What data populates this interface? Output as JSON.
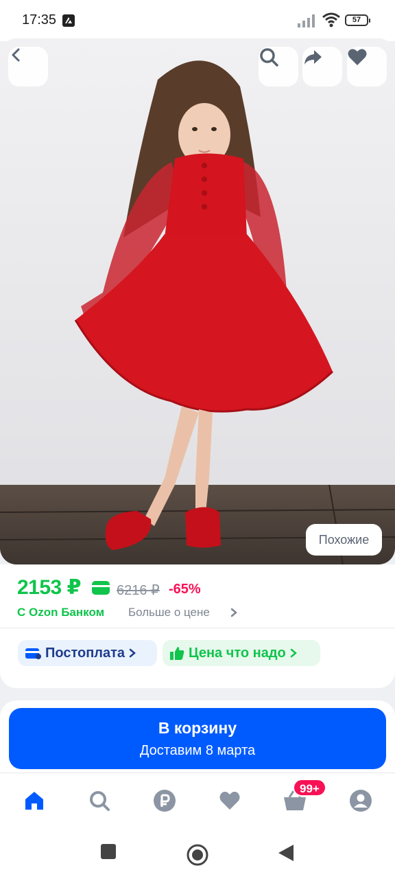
{
  "status_bar": {
    "time": "17:35",
    "battery": "57"
  },
  "product": {
    "image_description_icons": [
      "back-arrow-icon",
      "search-icon",
      "share-icon",
      "heart-icon"
    ],
    "similar_label": "Похожие"
  },
  "price": {
    "current": "2153 ₽",
    "old": "6216 ₽",
    "discount": "-65%",
    "bank_label": "С Ozon Банком",
    "more_label": "Больше о цене"
  },
  "chips": {
    "postpay": "Постоплата",
    "fair_price": "Цена что надо"
  },
  "cart": {
    "title": "В корзину",
    "delivery": "Доставим 8 марта"
  },
  "nav": {
    "cart_badge": "99+"
  },
  "colors": {
    "accent_blue": "#005bff",
    "price_green": "#10c44c",
    "discount_pink": "#f91155"
  }
}
